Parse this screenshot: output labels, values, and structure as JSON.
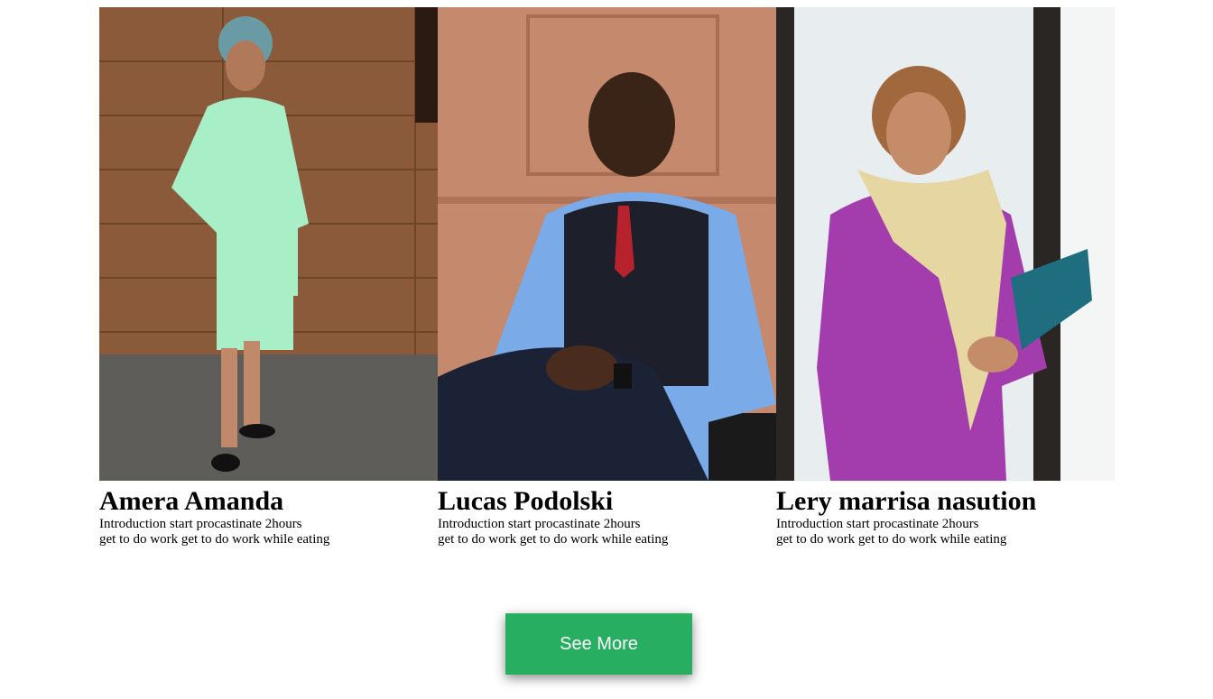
{
  "team": [
    {
      "photo_icon": "person-photo-icon",
      "name": "Amera Amanda",
      "intro_line1": "Introduction start procastinate 2hours",
      "intro_line2": "get to do work get to do work while eating"
    },
    {
      "photo_icon": "person-photo-icon",
      "name": "Lucas Podolski",
      "intro_line1": "Introduction start procastinate 2hours",
      "intro_line2": "get to do work get to do work while eating"
    },
    {
      "photo_icon": "person-photo-icon",
      "name": "Lery marrisa nasution",
      "intro_line1": "Introduction start procastinate 2hours",
      "intro_line2": "get to do work get to do work while eating"
    }
  ],
  "see_more_label": "See More",
  "colors": {
    "button": "#27ae60",
    "button_text": "#ffffff"
  }
}
